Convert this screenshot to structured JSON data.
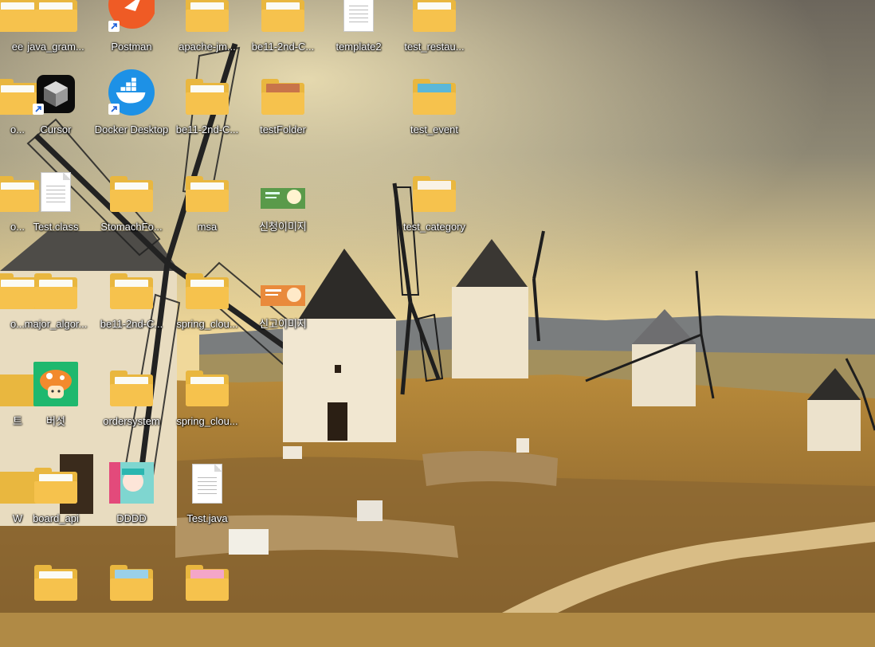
{
  "desktop": {
    "icons": [
      {
        "label": "ee",
        "type": "folder"
      },
      {
        "label": "java_gram...",
        "type": "folder"
      },
      {
        "label": "Postman",
        "type": "app-shortcut"
      },
      {
        "label": "apache-jm...",
        "type": "folder"
      },
      {
        "label": "be11-2nd-C...",
        "type": "folder"
      },
      {
        "label": "template2",
        "type": "document"
      },
      {
        "label": "test_restau...",
        "type": "folder"
      },
      {
        "label": "o...",
        "type": "folder"
      },
      {
        "label": "Cursor",
        "type": "app-shortcut"
      },
      {
        "label": "Docker Desktop",
        "type": "app-shortcut"
      },
      {
        "label": "be11-2nd-C...",
        "type": "folder"
      },
      {
        "label": "testFolder",
        "type": "folder"
      },
      {
        "label": "test_event",
        "type": "folder"
      },
      {
        "label": "o...",
        "type": "folder"
      },
      {
        "label": "Test.class",
        "type": "document"
      },
      {
        "label": "StomachFo...",
        "type": "folder"
      },
      {
        "label": "msa",
        "type": "folder"
      },
      {
        "label": "신청이미지",
        "type": "image"
      },
      {
        "label": "test_category",
        "type": "folder"
      },
      {
        "label": "o...",
        "type": "folder"
      },
      {
        "label": "major_algor...",
        "type": "folder"
      },
      {
        "label": "be11-2nd-C...",
        "type": "folder"
      },
      {
        "label": "spring_clou...",
        "type": "folder"
      },
      {
        "label": "신고이미지",
        "type": "image"
      },
      {
        "label": "트",
        "type": "app"
      },
      {
        "label": "버섯",
        "type": "app"
      },
      {
        "label": "ordersystem",
        "type": "folder"
      },
      {
        "label": "spring_clou...",
        "type": "folder"
      },
      {
        "label": "W",
        "type": "app"
      },
      {
        "label": "board_api",
        "type": "folder"
      },
      {
        "label": "DDDD",
        "type": "image"
      },
      {
        "label": "Test.java",
        "type": "document"
      },
      {
        "label": "",
        "type": "folder"
      },
      {
        "label": "",
        "type": "folder"
      },
      {
        "label": "",
        "type": "folder"
      }
    ]
  },
  "colors": {
    "folder": "#f6c24d",
    "postman": "#ef5b25",
    "docker": "#1d91e6",
    "label_text": "#ffffff"
  }
}
